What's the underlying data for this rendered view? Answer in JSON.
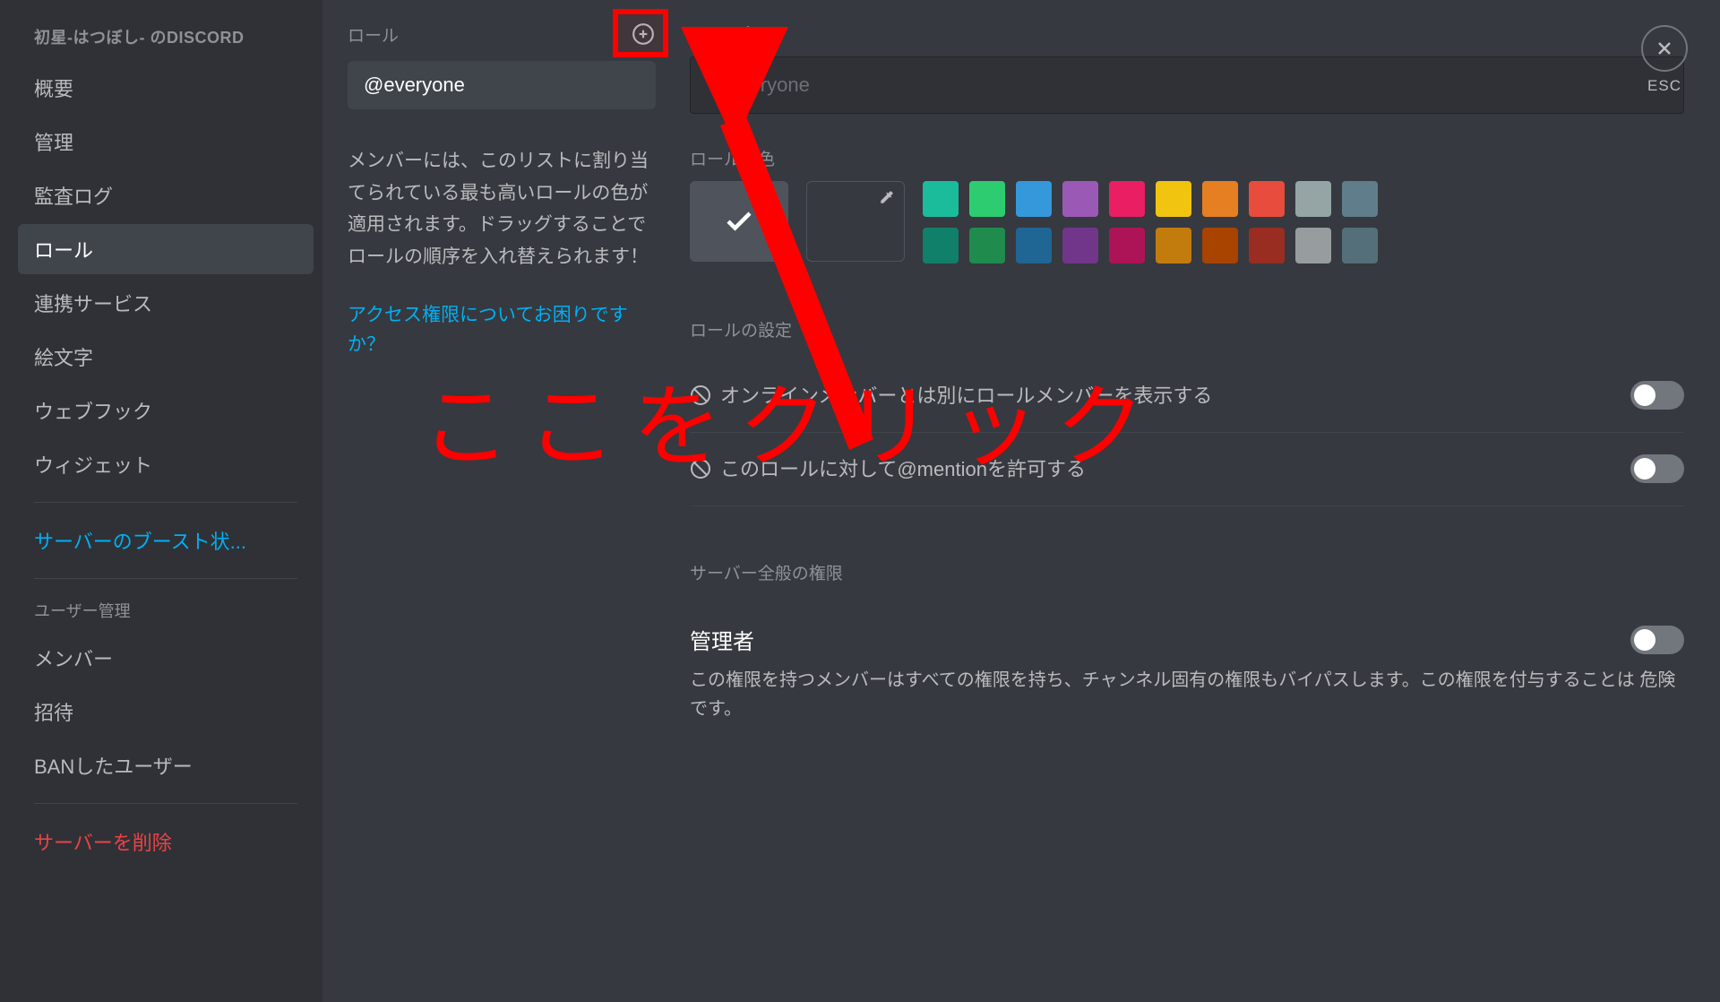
{
  "sidebar": {
    "server_name": "初星-はつぼし- のDISCORD",
    "items": [
      {
        "label": "概要",
        "active": false
      },
      {
        "label": "管理",
        "active": false
      },
      {
        "label": "監査ログ",
        "active": false
      },
      {
        "label": "ロール",
        "active": true
      },
      {
        "label": "連携サービス",
        "active": false
      },
      {
        "label": "絵文字",
        "active": false
      },
      {
        "label": "ウェブフック",
        "active": false
      },
      {
        "label": "ウィジェット",
        "active": false
      }
    ],
    "boost_label": "サーバーのブースト状...",
    "user_mgmt_title": "ユーザー管理",
    "user_mgmt_items": [
      {
        "label": "メンバー"
      },
      {
        "label": "招待"
      },
      {
        "label": "BANしたユーザー"
      }
    ],
    "delete_server_label": "サーバーを削除"
  },
  "role_list": {
    "header": "ロール",
    "items": [
      {
        "name": "@everyone"
      }
    ],
    "hint": "メンバーには、このリストに割り当てられている最も高いロールの色が適用されます。ドラッグすることでロールの順序を入れ替えられます！",
    "help_link": "アクセス権限についてお困りですか？"
  },
  "content": {
    "role_name_label": "ロール名",
    "role_name_placeholder": "@everyone",
    "role_color_label": "ロールの色",
    "swatch_colors_row1": [
      "#1abc9c",
      "#2ecc71",
      "#3498db",
      "#9b59b6",
      "#e91e63",
      "#f1c40f",
      "#e67e22",
      "#e74c3c",
      "#95a5a6",
      "#607d8b"
    ],
    "swatch_colors_row2": [
      "#11806a",
      "#1f8b4c",
      "#206694",
      "#71368a",
      "#ad1457",
      "#c27c0e",
      "#a84300",
      "#992d22",
      "#979c9f",
      "#546e7a"
    ],
    "role_settings_label": "ロールの設定",
    "perm_display_separate": "オンラインメンバーとは別にロールメンバーを表示する",
    "perm_allow_mention": "このロールに対して@mentionを許可する",
    "server_perm_title": "サーバー全般の権限",
    "perm_admin_title": "管理者",
    "perm_admin_desc": "この権限を持つメンバーはすべての権限を持ち、チャンネル固有の権限もバイパスします。この権限を付与することは 危険です。"
  },
  "close": {
    "label": "ESC"
  },
  "annotation": {
    "text": "ここをクリック"
  }
}
